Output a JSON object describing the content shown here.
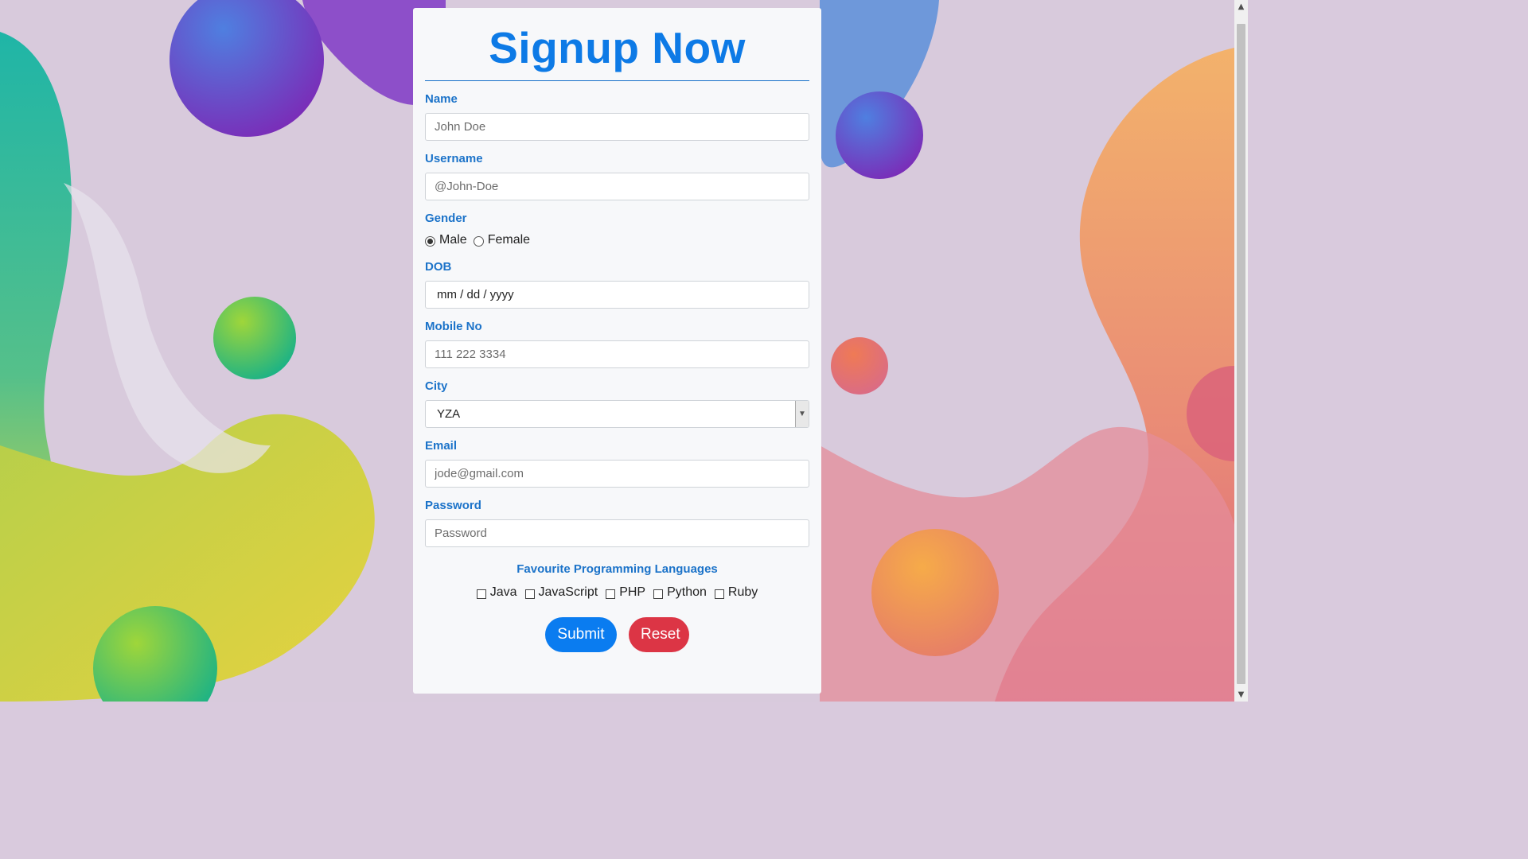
{
  "form": {
    "title": "Signup Now",
    "name": {
      "label": "Name",
      "placeholder": "John Doe"
    },
    "username": {
      "label": "Username",
      "placeholder": "@John-Doe"
    },
    "gender": {
      "label": "Gender",
      "options": [
        "Male",
        "Female"
      ],
      "selected": "Male"
    },
    "dob": {
      "label": "DOB",
      "placeholder": "mm / dd / yyyy"
    },
    "mobile": {
      "label": "Mobile No",
      "placeholder": "111 222 3334"
    },
    "city": {
      "label": "City",
      "selected": "YZA"
    },
    "email": {
      "label": "Email",
      "placeholder": "jode@gmail.com"
    },
    "password": {
      "label": "Password",
      "placeholder": "Password"
    },
    "languages": {
      "title": "Favourite Programming Languages",
      "options": [
        "Java",
        "JavaScript",
        "PHP",
        "Python",
        "Ruby"
      ]
    },
    "submit_label": "Submit",
    "reset_label": "Reset"
  },
  "colors": {
    "accent": "#0d7ae6",
    "submit": "#0a7cf0",
    "reset": "#dc3545",
    "card_bg": "#f7f8fa"
  },
  "icons": {
    "scroll_up": "chevron-up-icon",
    "scroll_down": "chevron-down-icon",
    "select_arrow": "chevron-down-icon"
  }
}
